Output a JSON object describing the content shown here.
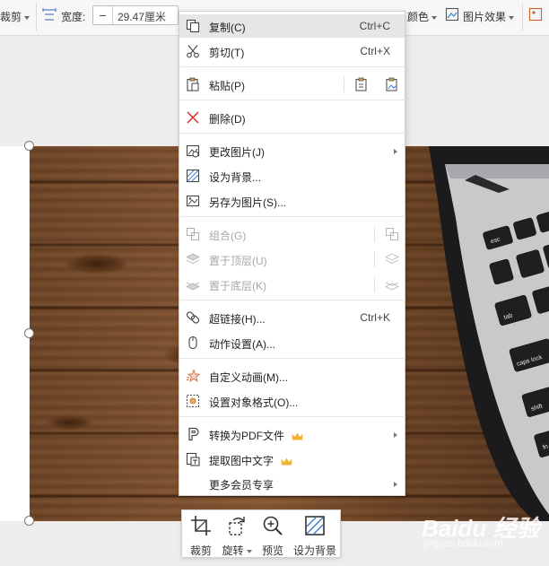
{
  "toolbar": {
    "crop_label": "裁剪",
    "width_label": "宽度:",
    "width_value": "29.47厘米",
    "width_minus": "−",
    "color_label": "颜色",
    "picture_effects_label": "图片效果"
  },
  "context_menu": {
    "items": [
      {
        "label": "复制(C)",
        "shortcut": "Ctrl+C",
        "icon": "copy-icon",
        "highlighted": true
      },
      {
        "label": "剪切(T)",
        "shortcut": "Ctrl+X",
        "icon": "scissors-icon"
      },
      {
        "label": "粘贴(P)",
        "icon": "paste-icon"
      },
      {
        "label": "删除(D)",
        "icon": "delete-x-icon"
      },
      {
        "label": "更改图片(J)",
        "icon": "change-picture-icon",
        "submenu": true
      },
      {
        "label": "设为背景...",
        "icon": "set-background-icon"
      },
      {
        "label": "另存为图片(S)...",
        "icon": "save-as-picture-icon"
      },
      {
        "label": "组合(G)",
        "icon": "group-icon",
        "disabled": true
      },
      {
        "label": "置于顶层(U)",
        "icon": "bring-to-front-icon",
        "disabled": true
      },
      {
        "label": "置于底层(K)",
        "icon": "send-to-back-icon",
        "disabled": true
      },
      {
        "label": "超链接(H)...",
        "shortcut": "Ctrl+K",
        "icon": "hyperlink-icon"
      },
      {
        "label": "动作设置(A)...",
        "icon": "mouse-icon"
      },
      {
        "label": "自定义动画(M)...",
        "icon": "star-animation-icon"
      },
      {
        "label": "设置对象格式(O)...",
        "icon": "format-object-icon"
      },
      {
        "label": "转换为PDF文件",
        "icon": "pdf-icon",
        "submenu": true,
        "premium": true
      },
      {
        "label": "提取图中文字",
        "icon": "extract-text-icon",
        "premium": true
      },
      {
        "label": "更多会员专享",
        "submenu": true
      }
    ]
  },
  "picture_toolbar": {
    "crop": "裁剪",
    "rotate": "旋转",
    "preview": "预览",
    "set_background": "设为背景"
  },
  "laptop_keys": [
    "esc",
    "tab",
    "caps lock",
    "shift",
    "fn"
  ],
  "watermark": {
    "brand": "Baidu 经验",
    "domain": "jingyan.baidu.com"
  },
  "colors": {
    "menu_highlight": "#e6e6e6",
    "delete_red": "#e0312f",
    "premium_gold": "#f2b233",
    "wood": "#7d5030"
  }
}
